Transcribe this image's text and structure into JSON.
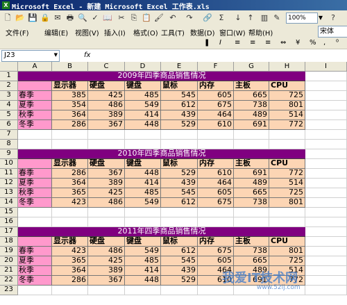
{
  "window": {
    "title": "Microsoft Excel - 新建 Microsoft Excel 工作表.xls"
  },
  "toolbar": {
    "zoom": "100%"
  },
  "menu": [
    "文件(F)",
    "编辑(E)",
    "视图(V)",
    "插入(I)",
    "格式(O)",
    "工具(T)",
    "数据(D)",
    "窗口(W)",
    "帮助(H)"
  ],
  "formatting": {
    "font": "宋体"
  },
  "formula_bar": {
    "name_box": "J23",
    "fx": "fx",
    "formula": ""
  },
  "columns": [
    "A",
    "B",
    "C",
    "D",
    "E",
    "F",
    "G",
    "H",
    "I"
  ],
  "rows": [
    "1",
    "2",
    "3",
    "4",
    "5",
    "6",
    "7",
    "8",
    "9",
    "10",
    "11",
    "12",
    "13",
    "14",
    "15",
    "16",
    "17",
    "18",
    "19",
    "20",
    "21",
    "22",
    "23"
  ],
  "headers": [
    "显示器",
    "硬盘",
    "键盘",
    "鼠标",
    "内存",
    "主板",
    "CPU"
  ],
  "tables": [
    {
      "title": "2009年四季商品销售情况",
      "rows": [
        {
          "season": "春季",
          "values": [
            "385",
            "425",
            "485",
            "545",
            "605",
            "665",
            "725"
          ]
        },
        {
          "season": "夏季",
          "values": [
            "354",
            "486",
            "549",
            "612",
            "675",
            "738",
            "801"
          ]
        },
        {
          "season": "秋季",
          "values": [
            "364",
            "389",
            "414",
            "439",
            "464",
            "489",
            "514"
          ]
        },
        {
          "season": "冬季",
          "values": [
            "286",
            "367",
            "448",
            "529",
            "610",
            "691",
            "772"
          ]
        }
      ]
    },
    {
      "title": "2010年四季商品销售情况",
      "rows": [
        {
          "season": "春季",
          "values": [
            "286",
            "367",
            "448",
            "529",
            "610",
            "691",
            "772"
          ]
        },
        {
          "season": "夏季",
          "values": [
            "364",
            "389",
            "414",
            "439",
            "464",
            "489",
            "514"
          ]
        },
        {
          "season": "秋季",
          "values": [
            "365",
            "425",
            "485",
            "545",
            "605",
            "665",
            "725"
          ]
        },
        {
          "season": "冬季",
          "values": [
            "423",
            "486",
            "549",
            "612",
            "675",
            "738",
            "801"
          ]
        }
      ]
    },
    {
      "title": "2011年四季商品销售情况",
      "rows": [
        {
          "season": "春季",
          "values": [
            "423",
            "486",
            "549",
            "612",
            "675",
            "738",
            "801"
          ]
        },
        {
          "season": "夏季",
          "values": [
            "365",
            "425",
            "485",
            "545",
            "605",
            "665",
            "725"
          ]
        },
        {
          "season": "秋季",
          "values": [
            "364",
            "389",
            "414",
            "439",
            "464",
            "489",
            "514"
          ]
        },
        {
          "season": "冬季",
          "values": [
            "286",
            "367",
            "448",
            "529",
            "610",
            "691",
            "772"
          ]
        }
      ]
    }
  ],
  "watermark": {
    "text": "我爱IT技术网",
    "url": "www.52ij.com"
  },
  "colors": {
    "title_bg": "#800080",
    "header_bg": "#fcd5b4",
    "season_bg": "#ff99cc"
  }
}
